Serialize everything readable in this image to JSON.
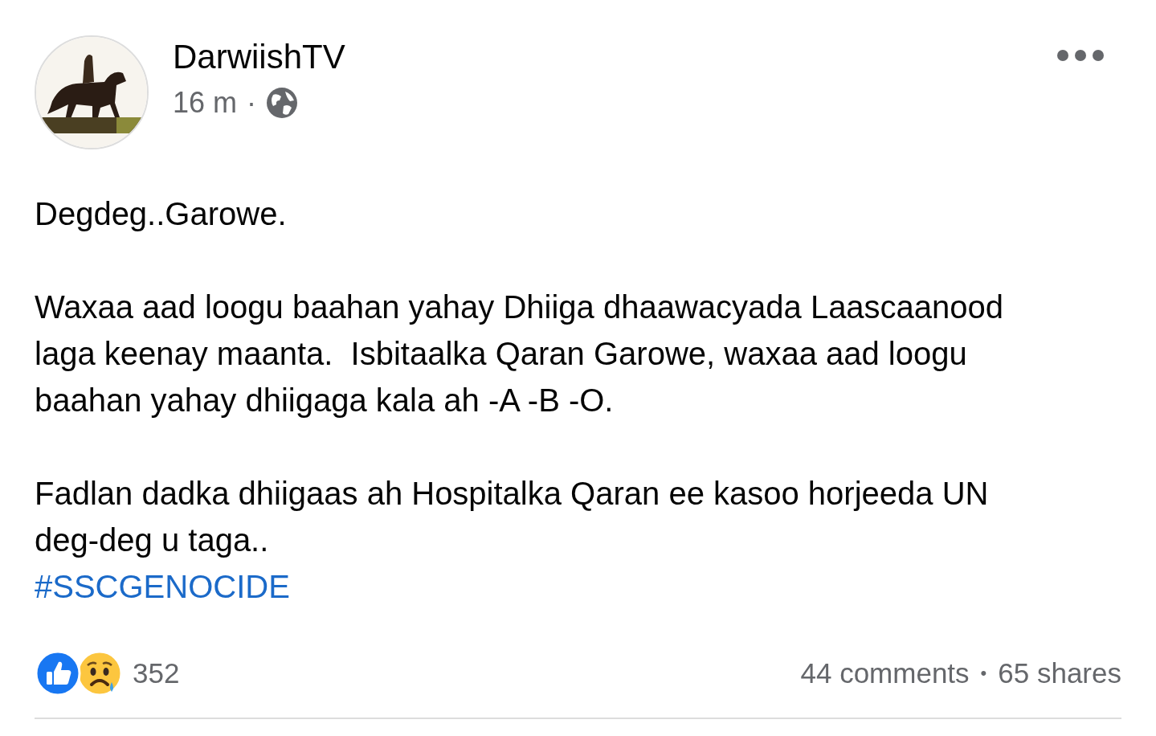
{
  "post": {
    "author": "DarwiishTV",
    "time": "16 m",
    "separator": "·",
    "public": true,
    "paragraphs": [
      "Degdeg..Garowe.",
      "Waxaa aad loogu baahan yahay Dhiiga dhaawacyada Laascaanood\nlaga keenay maanta.  Isbitaalka Qaran Garowe, waxaa aad loogu\nbaahan yahay dhiigaga kala ah -A -B -O.",
      "Fadlan dadka dhiigaas ah Hospitalka Qaran ee kasoo horjeeda UN\ndeg-deg u taga.."
    ],
    "hashtag": "#SSCGENOCIDE",
    "reactions": [
      {
        "kind": "like"
      },
      {
        "kind": "sad"
      }
    ],
    "reaction_count": "352",
    "comments": "44 comments",
    "dot": "•",
    "shares": "65 shares"
  }
}
